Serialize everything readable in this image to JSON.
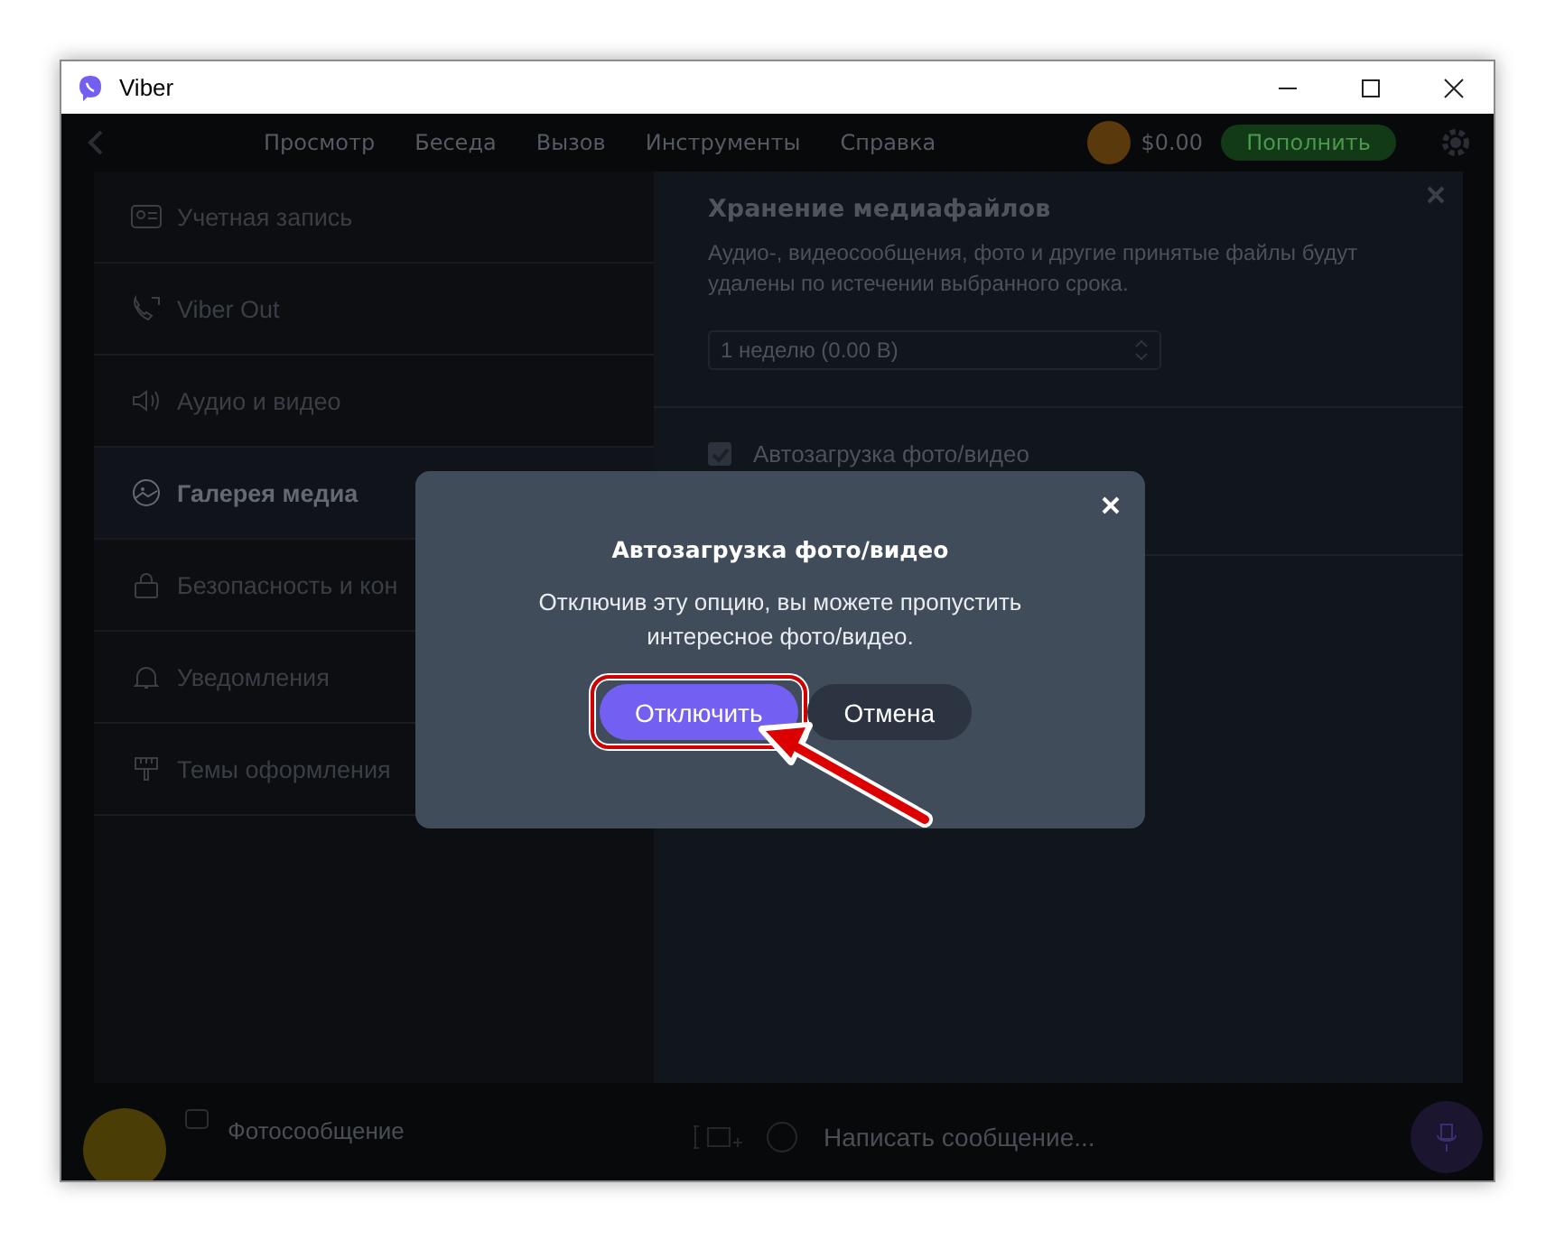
{
  "window": {
    "title": "Viber"
  },
  "toolbar": {
    "menu": [
      "Просмотр",
      "Беседа",
      "Вызов",
      "Инструменты",
      "Справка"
    ],
    "balance": "$0.00",
    "top_up_button": "Пополнить"
  },
  "settings": {
    "sidebar": {
      "items": [
        {
          "label": "Учетная запись",
          "selected": false
        },
        {
          "label": "Viber Out",
          "selected": false
        },
        {
          "label": "Аудио и видео",
          "selected": false
        },
        {
          "label": "Галерея медиа",
          "selected": true
        },
        {
          "label": "Безопасность и кон",
          "selected": false
        },
        {
          "label": "Уведомления",
          "selected": false
        },
        {
          "label": "Темы оформления",
          "selected": false
        }
      ]
    },
    "panel": {
      "title": "Хранение медиафайлов",
      "description": "Аудио-, видеосообщения, фото и другие принятые файлы будут удалены по истечении выбранного срока.",
      "period_select": {
        "value": "1 неделю (0.00 B)"
      },
      "auto_download": {
        "label": "Автозагрузка фото/видео",
        "checked": true
      }
    }
  },
  "chat": {
    "last_message": "Фотосообщение",
    "message_field": {
      "placeholder": "Написать сообщение..."
    }
  },
  "dialog": {
    "title": "Автозагрузка фото/видео",
    "message": "Отключив эту опцию, вы можете пропустить интересное фото/видео.",
    "buttons": [
      {
        "label": "Отключить",
        "kind": "primary",
        "highlighted": true
      },
      {
        "label": "Отмена",
        "kind": "secondary",
        "highlighted": false
      }
    ]
  }
}
